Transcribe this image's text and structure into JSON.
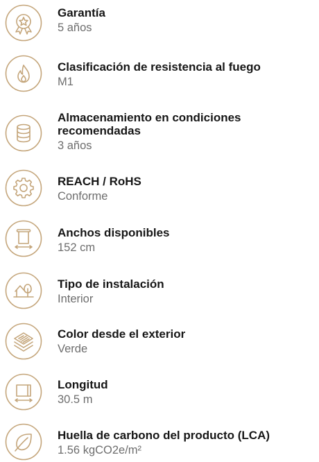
{
  "specs": [
    {
      "title": "Garantía",
      "value": "5 años",
      "icon": "warranty-badge-icon"
    },
    {
      "title": "Clasificación de resistencia al fuego",
      "value": "M1",
      "icon": "flame-icon"
    },
    {
      "title": "Almacenamiento en condiciones recomendadas",
      "value": "3 años",
      "icon": "storage-database-icon"
    },
    {
      "title": "REACH / RoHS",
      "value": "Conforme",
      "icon": "gear-icon"
    },
    {
      "title": "Anchos disponibles",
      "value": "152 cm",
      "icon": "roll-width-icon"
    },
    {
      "title": "Tipo de instalación",
      "value": "Interior",
      "icon": "indoor-plant-icon"
    },
    {
      "title": "Color desde el exterior",
      "value": "Verde",
      "icon": "layers-icon"
    },
    {
      "title": "Longitud",
      "value": "30.5 m",
      "icon": "roll-length-icon"
    },
    {
      "title": "Huella de carbono del producto (LCA)",
      "value": "1.56 kgCO2e/m²",
      "icon": "leaf-icon"
    }
  ],
  "colors": {
    "icon": "#c4a57a",
    "title": "#161616",
    "value": "#6d6d6d"
  }
}
